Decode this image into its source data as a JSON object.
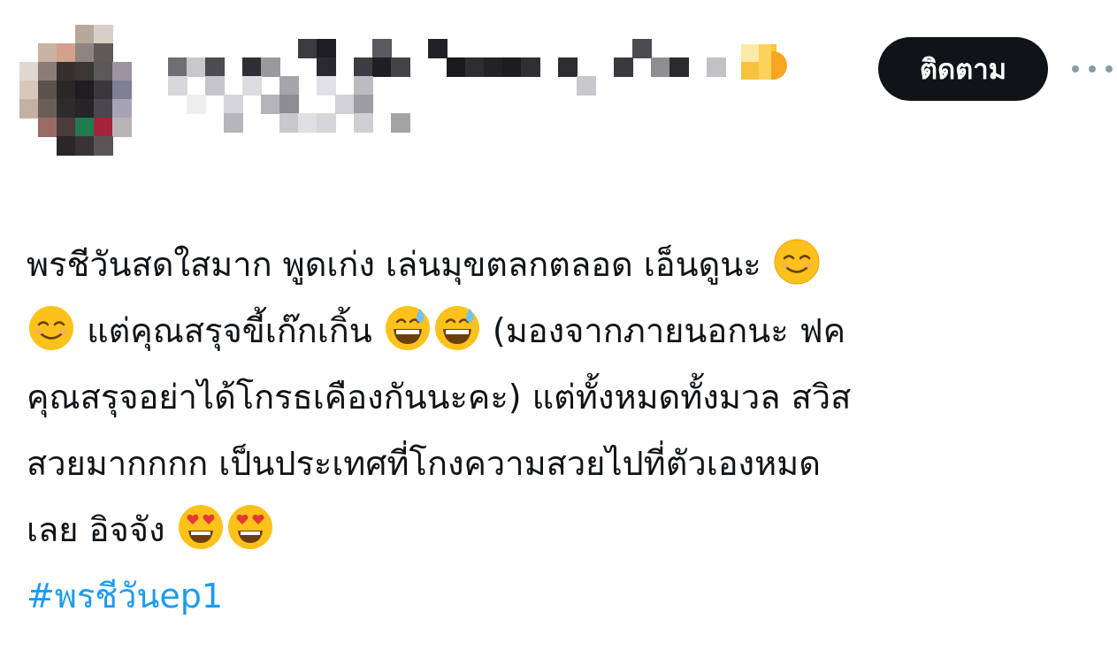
{
  "author": {
    "avatar_state": "pixelated",
    "name_state": "pixelated",
    "verified_badge_icon": "badge-icon"
  },
  "actions": {
    "follow_label": "ติดตาม",
    "more_icon": "more-horizontal-icon"
  },
  "tweet": {
    "lines": [
      {
        "segments": [
          {
            "text": "พรชีวันสดใสมาก พูดเก่ง เล่นมุขตลกตลอด เอ็นดูนะ "
          },
          {
            "emoji": "smiling-face-icon"
          }
        ]
      },
      {
        "segments": [
          {
            "emoji": "smiling-face-icon"
          },
          {
            "text": " แต่คุณสรุจขี้เก๊กเกิ้น "
          },
          {
            "emoji": "grinning-sweat-icon"
          },
          {
            "emoji": "grinning-sweat-icon"
          },
          {
            "text": " (มองจากภายนอกนะ ฟค"
          }
        ]
      },
      {
        "segments": [
          {
            "text": "คุณสรุจอย่าได้โกรธเคืองกันนะคะ) แต่ทั้งหมดทั้งมวล สวิส"
          }
        ]
      },
      {
        "segments": [
          {
            "text": "สวยมากกกก เป็นประเทศที่โกงความสวยไปที่ตัวเองหมด"
          }
        ]
      },
      {
        "segments": [
          {
            "text": "เลย อิจจัง "
          },
          {
            "emoji": "heart-eyes-icon"
          },
          {
            "emoji": "heart-eyes-icon"
          }
        ]
      }
    ],
    "hashtag": "#พรชีวันep1"
  },
  "colors": {
    "text": "#0f1419",
    "link": "#1d9bf0",
    "follow_bg": "#0f1419",
    "follow_text": "#ffffff",
    "muted": "#8b98a5"
  }
}
